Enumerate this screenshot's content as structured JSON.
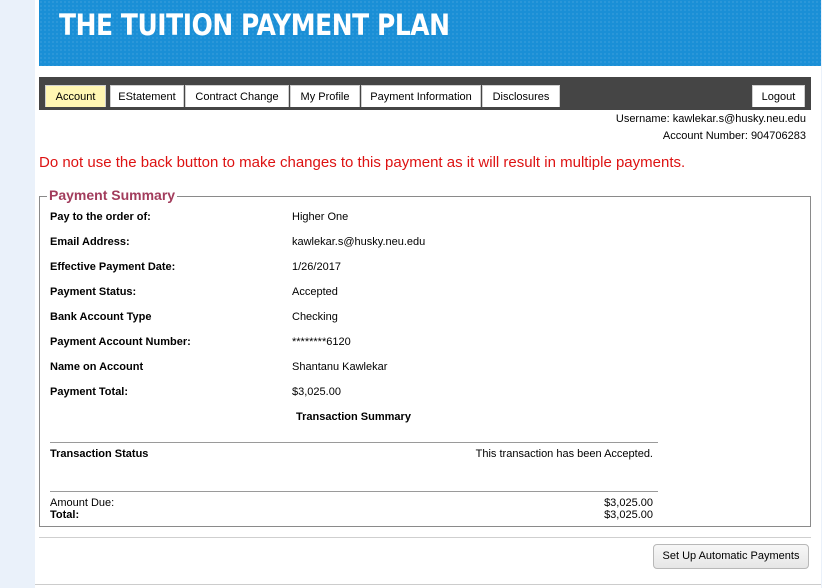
{
  "banner": {
    "title": "THE TUITION PAYMENT PLAN"
  },
  "nav": {
    "tabs": [
      "Account",
      "EStatement",
      "Contract Change",
      "My Profile",
      "Payment Information",
      "Disclosures"
    ],
    "active": "Account",
    "logout": "Logout"
  },
  "user": {
    "username_label": "Username:",
    "username": "kawlekar.s@husky.neu.edu",
    "account_label": "Account Number:",
    "account_number": "904706283"
  },
  "warning": "Do not use the back button to make changes to this payment as it will result in multiple payments.",
  "summary": {
    "legend": "Payment Summary",
    "rows": [
      {
        "label": "Pay to the order of:",
        "value": "Higher One"
      },
      {
        "label": "Email Address:",
        "value": "kawlekar.s@husky.neu.edu"
      },
      {
        "label": "Effective Payment Date:",
        "value": "1/26/2017"
      },
      {
        "label": "Payment Status:",
        "value": "Accepted"
      },
      {
        "label": "Bank Account Type",
        "value": "Checking"
      },
      {
        "label": "Payment Account Number:",
        "value": "********6120"
      },
      {
        "label": "Name on Account",
        "value": "Shantanu Kawlekar"
      },
      {
        "label": "Payment Total:",
        "value": "$3,025.00"
      }
    ],
    "transaction_heading": "Transaction Summary",
    "transaction_status_label": "Transaction Status",
    "transaction_status_value": "This transaction has been Accepted.",
    "amount_due_label": "Amount Due:",
    "amount_due_value": "$3,025.00",
    "total_label": "Total:",
    "total_value": "$3,025.00"
  },
  "actions": {
    "setup_auto": "Set Up Automatic Payments"
  },
  "colors": {
    "banner": "#1a8fd6",
    "navbar": "#454545",
    "active_tab": "#fff6b3",
    "warning": "#dd1212",
    "legend": "#a23c5c"
  }
}
